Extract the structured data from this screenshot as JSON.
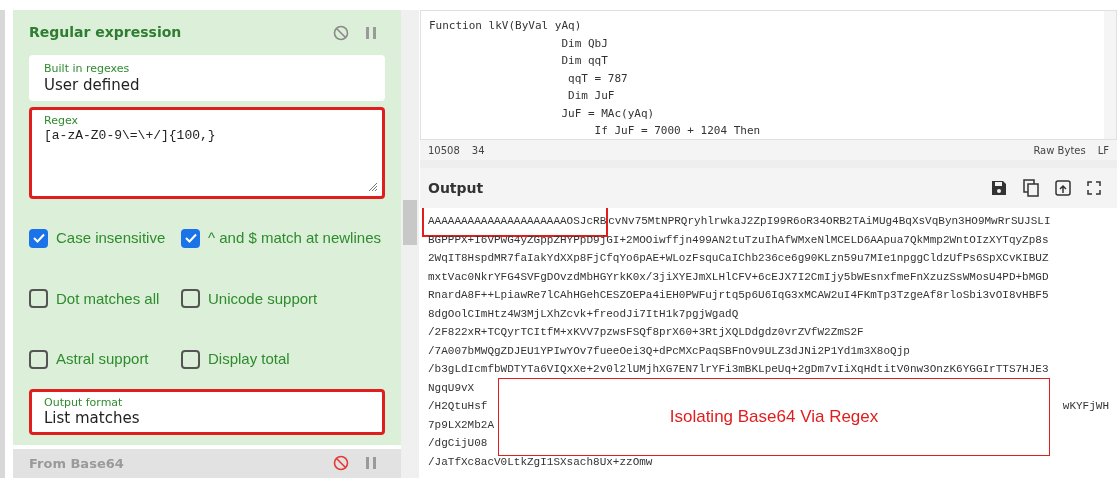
{
  "operation": {
    "title": "Regular expression",
    "disabled": false,
    "paused": false,
    "fields": [
      {
        "kind": "select",
        "label": "Built in regexes",
        "value": "User defined",
        "highlighted": false
      },
      {
        "kind": "textarea",
        "label": "Regex",
        "value": "[a-zA-Z0-9\\=\\+/]{100,}",
        "highlighted": true
      }
    ],
    "options": [
      {
        "label": "Case insensitive",
        "checked": true
      },
      {
        "label": "^ and $ match at newlines",
        "checked": true
      },
      {
        "label": "Dot matches all",
        "checked": false
      },
      {
        "label": "Unicode support",
        "checked": false
      },
      {
        "label": "Astral support",
        "checked": false
      },
      {
        "label": "Display total",
        "checked": false
      }
    ],
    "output_format": {
      "label": "Output format",
      "value": "List matches",
      "highlighted": true
    }
  },
  "next_operation": {
    "title": "From Base64",
    "disabled": true
  },
  "input": {
    "lines": [
      "Function lkV(ByVal yAq)",
      "                    Dim QbJ",
      "                    Dim qqT",
      "                     qqT = 787",
      "                     Dim JuF",
      "                    JuF = MAc(yAq)",
      "                         If JuF = 7000 + 1204 Then"
    ],
    "length": "10508",
    "line_count": "34",
    "encoding": "Raw Bytes",
    "eol": "LF"
  },
  "output": {
    "title": "Output",
    "lines": [
      {
        "highlight": "AAAAAAAAAAAAAAAAAAAAAOSJcRB",
        "text": "cvNv75MtNPRQryhlrwkaJ2ZpI99R6oR34ORB2TAiMUg4BqXsVqByn3HO9MwRrSUJSLI"
      },
      {
        "text": "BGPPPX+I6VPwG4yZGppZHYPpD9jGI+2MOOiwffjn499AN2tuTzuIhAfWMxeNlMCELD6AApua7QkMmp2WntOIzXYTqyZp8s"
      },
      {
        "text": "2WqIT8HspdMR7faIakYdXXp8FjCfqYo6pAE+WLozFsquCaIChb236ce6g90KLzn59u7MIe1npggCldzUfPs6SpXCvKIBUZ"
      },
      {
        "text": "mxtVac0NkrYFG4SVFgDOvzdMbHGYrkK0x/3jiXYEJmXLHlCFV+6cEJX7I2CmIjy5bWEsnxfmeFnXzuzSsWMosU4PD+bMGD"
      },
      {
        "text": "RnardA8F++LpiawRe7lCAhHGehCESZOEPa4iEH0PWFujrtq5p6U6IqG3xMCAW2uI4FKmTp3TzgeAf8rloSbi3vOI8vHBF5"
      },
      {
        "text": "8dgOolCImHtz4W3MjLXhZcvk+freodJi7ItH1k7pgjWgadQ"
      },
      {
        "text": "/2F822xR+TCQyrTCItfM+xKVV7pzwsFSQf8prX60+3RtjXQLDdgdz0vrZVfW2ZmS2F"
      },
      {
        "text": "/7A007bMWQgZDJEU1YPIwYOv7fueeOei3Q+dPcMXcPaqSBFnOv9ULZ3dJNi2P1Yd1m3X8oQjp"
      },
      {
        "text": "/b3gLdIcmfbWDTYTa6VIQxXe+2v0l2lUMjhXG7EN7lrYFi3mBKLpeUq+2gDm7vIiXqHdtitV0nw3OnzK6YGGIrTTS7HJE3"
      },
      {
        "text": "NgqU9vX"
      },
      {
        "text": "/H2QtuHsf",
        "tail": "wKYFjWH"
      },
      {
        "text": "7p9LX2Mb2A"
      },
      {
        "text": "/dgCijU08"
      },
      {
        "text": "/JaTfXc8acV0LtkZgI1SXsach8Ux+zzOmw"
      }
    ]
  },
  "callout": {
    "text": "Isolating Base64 Via Regex"
  }
}
